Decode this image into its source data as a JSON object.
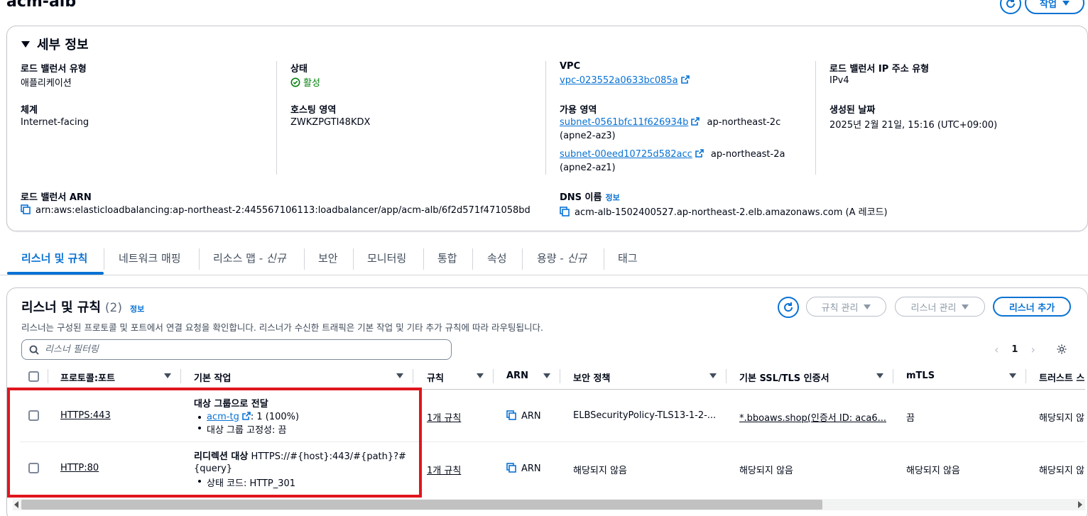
{
  "header": {
    "title": "acm-alb",
    "actions_label": "작업"
  },
  "details": {
    "section_title": "세부 정보",
    "lb_type_label": "로드 밸런서 유형",
    "lb_type_value": "애플리케이션",
    "scheme_label": "체계",
    "scheme_value": "Internet-facing",
    "status_label": "상태",
    "status_value": "활성",
    "hosted_zone_label": "호스팅 영역",
    "hosted_zone_value": "ZWKZPGTI48KDX",
    "vpc_label": "VPC",
    "vpc_value": "vpc-023552a0633bc085a",
    "az_label": "가용 영역",
    "subnet1": "subnet-0561bfc11f626934b",
    "subnet1_zone": "ap-northeast-2c",
    "subnet1_az": "(apne2-az3)",
    "subnet2": "subnet-00eed10725d582acc",
    "subnet2_zone": "ap-northeast-2a",
    "subnet2_az": "(apne2-az1)",
    "ip_type_label": "로드 밸런서 IP 주소 유형",
    "ip_type_value": "IPv4",
    "created_label": "생성된 날짜",
    "created_value": "2025년 2월 21일, 15:16 (UTC+09:00)",
    "arn_label": "로드 밸런서 ARN",
    "arn_value": "arn:aws:elasticloadbalancing:ap-northeast-2:445567106113:loadbalancer/app/acm-alb/6f2d571f471058bd",
    "dns_label": "DNS 이름",
    "dns_info": "정보",
    "dns_value": "acm-alb-1502400527.ap-northeast-2.elb.amazonaws.com (A 레코드)"
  },
  "tabs": [
    {
      "label": "리스너 및 규칙",
      "suffix": ""
    },
    {
      "label": "네트워크 매핑",
      "suffix": ""
    },
    {
      "label": "리소스 맵 - ",
      "suffix": "신규"
    },
    {
      "label": "보안",
      "suffix": ""
    },
    {
      "label": "모니터링",
      "suffix": ""
    },
    {
      "label": "통합",
      "suffix": ""
    },
    {
      "label": "속성",
      "suffix": ""
    },
    {
      "label": "용량 - ",
      "suffix": "신규"
    },
    {
      "label": "태그",
      "suffix": ""
    }
  ],
  "listeners": {
    "title": "리스너 및 규칙",
    "count": "(2)",
    "info": "정보",
    "description": "리스너는 구성된 프로토콜 및 포트에서 연결 요청을 확인합니다. 리스너가 수신한 트래픽은 기본 작업 및 기타 추가 규칙에 따라 라우팅됩니다.",
    "manage_rules": "규칙 관리",
    "manage_listener": "리스너 관리",
    "add_listener": "리스너 추가",
    "search_placeholder": "리스너 필터링",
    "page": "1",
    "columns": [
      "프로토콜:포트",
      "기본 작업",
      "규칙",
      "ARN",
      "보안 정책",
      "기본 SSL/TLS 인증서",
      "mTLS",
      "트러스트 스"
    ],
    "rows": [
      {
        "protocol": "HTTPS:443",
        "action_title": "대상 그룹으로 전달",
        "action_tg": "acm-tg",
        "action_tg_weight": ": 1 (100%)",
        "action_stickiness": "대상 그룹 고정성: 끔",
        "rules": "1개 규칙",
        "arn": "ARN",
        "policy": "ELBSecurityPolicy-TLS13-1-2-...",
        "cert": "*.bboaws.shop(인증서 ID: aca6...",
        "mtls": "끔",
        "trust": "해당되지 않"
      },
      {
        "protocol": "HTTP:80",
        "action_title": "리디렉션 대상",
        "action_target_1": "HTTPS://#{host}:443/#{path}?#",
        "action_target_2": "{query}",
        "action_status": "상태 코드: HTTP_301",
        "rules": "1개 규칙",
        "arn": "ARN",
        "policy": "해당되지 않음",
        "cert": "해당되지 않음",
        "mtls": "해당되지 않음",
        "trust": "해당되지 않"
      }
    ]
  },
  "colors": {
    "accent": "#0972d3",
    "success": "#037f0c",
    "highlight": "#e0161e"
  }
}
